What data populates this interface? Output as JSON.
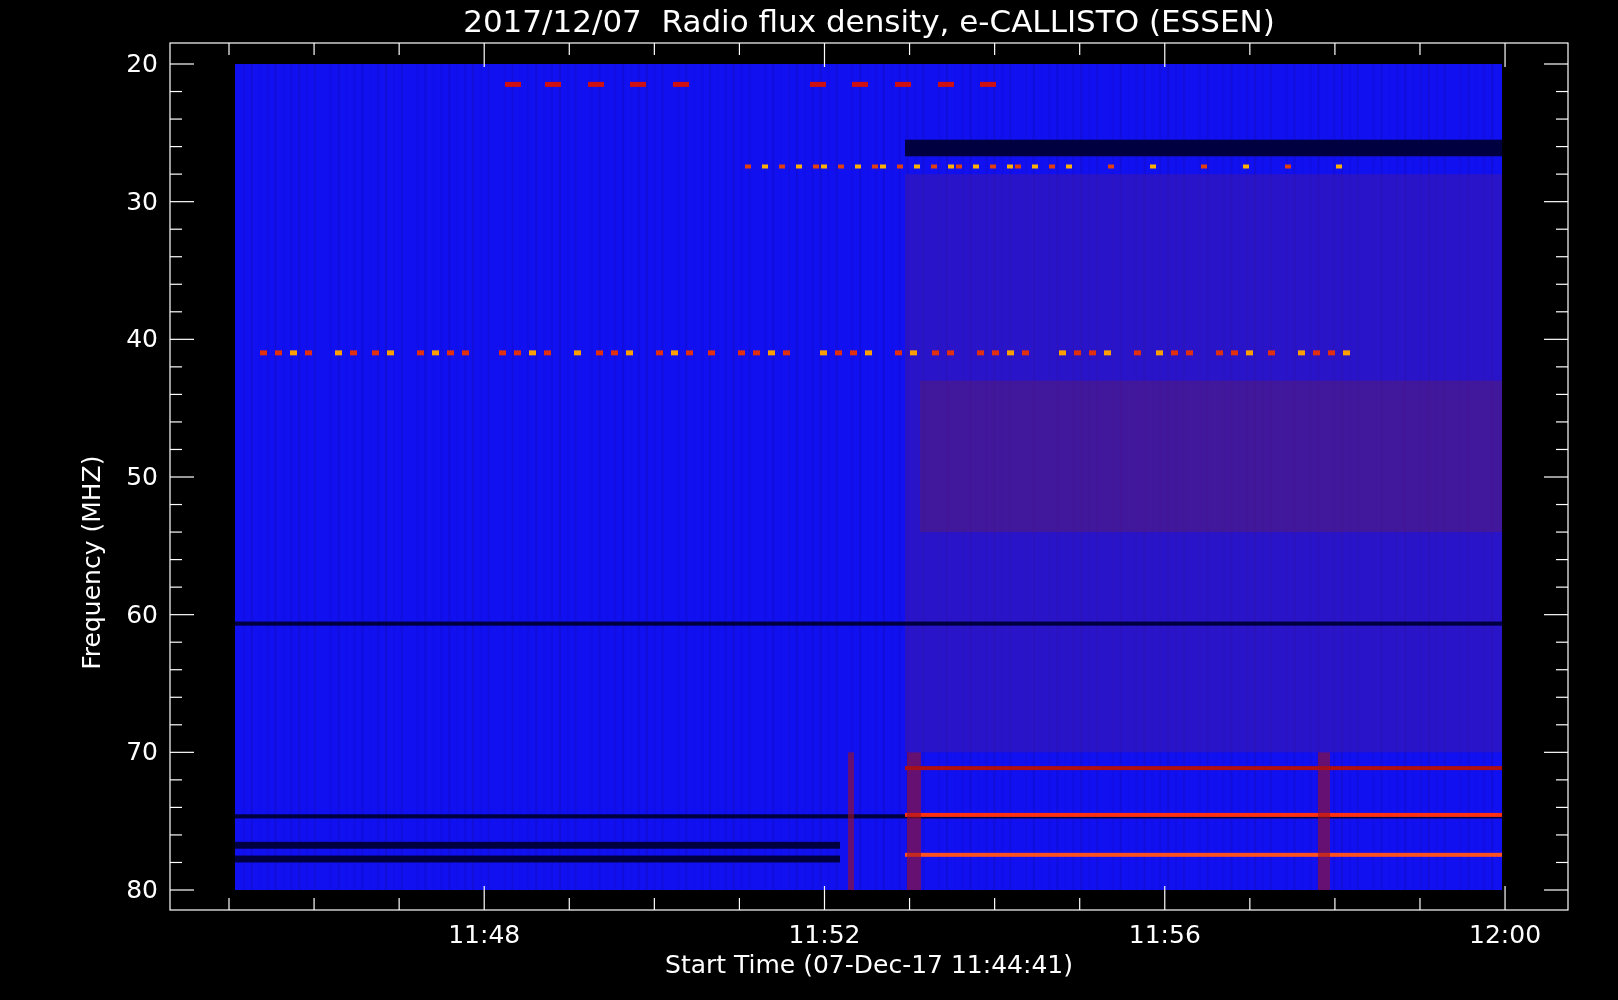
{
  "title": "2017/12/07  Radio flux density, e-CALLISTO (ESSEN)",
  "y_axis": {
    "label": "Frequency (MHZ)",
    "ticks": [
      "20",
      "30",
      "40",
      "50",
      "60",
      "70",
      "80"
    ]
  },
  "x_axis": {
    "label": "Start Time (07-Dec-17 11:44:41)",
    "ticks": [
      "11:48",
      "11:52",
      "11:56",
      "12:00"
    ]
  }
}
